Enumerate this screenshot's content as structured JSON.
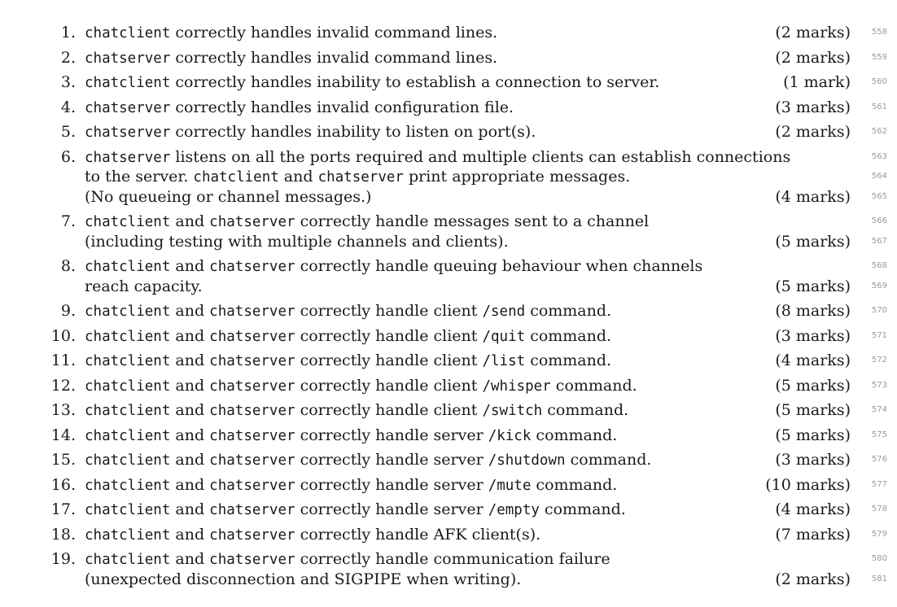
{
  "items": [
    {
      "number": "1.",
      "lines": [
        [
          {
            "t": "chatclient",
            "code": true
          },
          {
            "t": " correctly handles invalid command lines."
          }
        ]
      ],
      "marks": "(2 marks)",
      "line_numbers": [
        "558"
      ]
    },
    {
      "number": "2.",
      "lines": [
        [
          {
            "t": "chatserver",
            "code": true
          },
          {
            "t": " correctly handles invalid command lines."
          }
        ]
      ],
      "marks": "(2 marks)",
      "line_numbers": [
        "559"
      ]
    },
    {
      "number": "3.",
      "lines": [
        [
          {
            "t": "chatclient",
            "code": true
          },
          {
            "t": " correctly handles inability to establish a connection to server."
          }
        ]
      ],
      "marks": "(1 mark)",
      "line_numbers": [
        "560"
      ]
    },
    {
      "number": "4.",
      "lines": [
        [
          {
            "t": "chatserver",
            "code": true
          },
          {
            "t": " correctly handles invalid configuration file."
          }
        ]
      ],
      "marks": "(3 marks)",
      "line_numbers": [
        "561"
      ]
    },
    {
      "number": "5.",
      "lines": [
        [
          {
            "t": "chatserver",
            "code": true
          },
          {
            "t": " correctly handles inability to listen on port(s)."
          }
        ]
      ],
      "marks": "(2 marks)",
      "line_numbers": [
        "562"
      ]
    },
    {
      "number": "6.",
      "lines": [
        [
          {
            "t": "chatserver",
            "code": true
          },
          {
            "t": " listens on all the ports required and multiple clients can establish connections"
          }
        ],
        [
          {
            "t": "to the server. "
          },
          {
            "t": "chatclient",
            "code": true
          },
          {
            "t": " and "
          },
          {
            "t": "chatserver",
            "code": true
          },
          {
            "t": " print appropriate messages."
          }
        ],
        [
          {
            "t": "(No queueing or channel messages.)"
          }
        ]
      ],
      "marks": "(4 marks)",
      "line_numbers": [
        "563",
        "564",
        "565"
      ]
    },
    {
      "number": "7.",
      "lines": [
        [
          {
            "t": "chatclient",
            "code": true
          },
          {
            "t": " and "
          },
          {
            "t": "chatserver",
            "code": true
          },
          {
            "t": " correctly handle messages sent to a channel"
          }
        ],
        [
          {
            "t": "(including testing with multiple channels and clients)."
          }
        ]
      ],
      "marks": "(5 marks)",
      "line_numbers": [
        "566",
        "567"
      ]
    },
    {
      "number": "8.",
      "lines": [
        [
          {
            "t": "chatclient",
            "code": true
          },
          {
            "t": " and "
          },
          {
            "t": "chatserver",
            "code": true
          },
          {
            "t": " correctly handle queuing behaviour when channels"
          }
        ],
        [
          {
            "t": "reach capacity."
          }
        ]
      ],
      "marks": "(5 marks)",
      "line_numbers": [
        "568",
        "569"
      ]
    },
    {
      "number": "9.",
      "lines": [
        [
          {
            "t": "chatclient",
            "code": true
          },
          {
            "t": " and "
          },
          {
            "t": "chatserver",
            "code": true
          },
          {
            "t": " correctly handle client "
          },
          {
            "t": "/send",
            "code": true
          },
          {
            "t": " command."
          }
        ]
      ],
      "marks": "(8 marks)",
      "line_numbers": [
        "570"
      ]
    },
    {
      "number": "10.",
      "lines": [
        [
          {
            "t": "chatclient",
            "code": true
          },
          {
            "t": " and "
          },
          {
            "t": "chatserver",
            "code": true
          },
          {
            "t": " correctly handle client "
          },
          {
            "t": "/quit",
            "code": true
          },
          {
            "t": " command."
          }
        ]
      ],
      "marks": "(3 marks)",
      "line_numbers": [
        "571"
      ]
    },
    {
      "number": "11.",
      "lines": [
        [
          {
            "t": "chatclient",
            "code": true
          },
          {
            "t": " and "
          },
          {
            "t": "chatserver",
            "code": true
          },
          {
            "t": " correctly handle client "
          },
          {
            "t": "/list",
            "code": true
          },
          {
            "t": " command."
          }
        ]
      ],
      "marks": "(4 marks)",
      "line_numbers": [
        "572"
      ]
    },
    {
      "number": "12.",
      "lines": [
        [
          {
            "t": "chatclient",
            "code": true
          },
          {
            "t": " and "
          },
          {
            "t": "chatserver",
            "code": true
          },
          {
            "t": " correctly handle client "
          },
          {
            "t": "/whisper",
            "code": true
          },
          {
            "t": " command."
          }
        ]
      ],
      "marks": "(5 marks)",
      "line_numbers": [
        "573"
      ]
    },
    {
      "number": "13.",
      "lines": [
        [
          {
            "t": "chatclient",
            "code": true
          },
          {
            "t": " and "
          },
          {
            "t": "chatserver",
            "code": true
          },
          {
            "t": " correctly handle client "
          },
          {
            "t": "/switch",
            "code": true
          },
          {
            "t": " command."
          }
        ]
      ],
      "marks": "(5 marks)",
      "line_numbers": [
        "574"
      ]
    },
    {
      "number": "14.",
      "lines": [
        [
          {
            "t": "chatclient",
            "code": true
          },
          {
            "t": " and "
          },
          {
            "t": "chatserver",
            "code": true
          },
          {
            "t": " correctly handle server "
          },
          {
            "t": "/kick",
            "code": true
          },
          {
            "t": " command."
          }
        ]
      ],
      "marks": "(5 marks)",
      "line_numbers": [
        "575"
      ]
    },
    {
      "number": "15.",
      "lines": [
        [
          {
            "t": "chatclient",
            "code": true
          },
          {
            "t": " and "
          },
          {
            "t": "chatserver",
            "code": true
          },
          {
            "t": " correctly handle server "
          },
          {
            "t": "/shutdown",
            "code": true
          },
          {
            "t": " command."
          }
        ]
      ],
      "marks": "(3 marks)",
      "line_numbers": [
        "576"
      ]
    },
    {
      "number": "16.",
      "lines": [
        [
          {
            "t": "chatclient",
            "code": true
          },
          {
            "t": " and "
          },
          {
            "t": "chatserver",
            "code": true
          },
          {
            "t": " correctly handle server "
          },
          {
            "t": "/mute",
            "code": true
          },
          {
            "t": " command."
          }
        ]
      ],
      "marks": "(10 marks)",
      "line_numbers": [
        "577"
      ]
    },
    {
      "number": "17.",
      "lines": [
        [
          {
            "t": "chatclient",
            "code": true
          },
          {
            "t": " and "
          },
          {
            "t": "chatserver",
            "code": true
          },
          {
            "t": " correctly handle server "
          },
          {
            "t": "/empty",
            "code": true
          },
          {
            "t": " command."
          }
        ]
      ],
      "marks": "(4 marks)",
      "line_numbers": [
        "578"
      ]
    },
    {
      "number": "18.",
      "lines": [
        [
          {
            "t": "chatclient",
            "code": true
          },
          {
            "t": " and "
          },
          {
            "t": "chatserver",
            "code": true
          },
          {
            "t": " correctly handle AFK client(s)."
          }
        ]
      ],
      "marks": "(7 marks)",
      "line_numbers": [
        "579"
      ]
    },
    {
      "number": "19.",
      "lines": [
        [
          {
            "t": "chatclient",
            "code": true
          },
          {
            "t": " and "
          },
          {
            "t": "chatserver",
            "code": true
          },
          {
            "t": " correctly handle communication failure"
          }
        ],
        [
          {
            "t": "(unexpected disconnection and SIGPIPE when writing)."
          }
        ]
      ],
      "marks": "(2 marks)",
      "line_numbers": [
        "580",
        "581"
      ]
    }
  ]
}
